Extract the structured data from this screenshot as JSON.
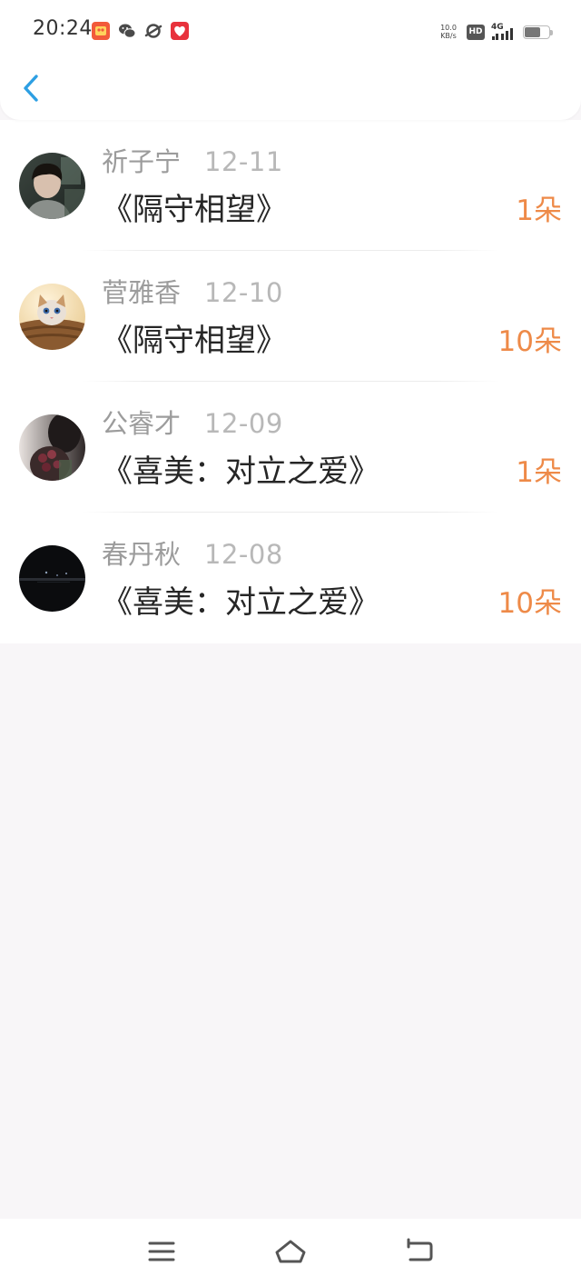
{
  "status_bar": {
    "time": "20:24",
    "net_speed_value": "10.0",
    "net_speed_unit": "KB/s",
    "hd_label": "HD",
    "network_label": "4G",
    "battery_level": 0.65,
    "app_icons": [
      "app-store-icon",
      "wechat-icon",
      "browser-icon",
      "heart-app-icon"
    ]
  },
  "header": {
    "back_icon": "chevron-left-icon",
    "accent_color": "#2d9fe3"
  },
  "items": [
    {
      "name": "祈子宁",
      "date": "12-11",
      "title": "《隔守相望》",
      "count": "1朵"
    },
    {
      "name": "菅雅香",
      "date": "12-10",
      "title": "《隔守相望》",
      "count": "10朵"
    },
    {
      "name": "公睿才",
      "date": "12-09",
      "title": "《喜美：对立之爱》",
      "count": "1朵"
    },
    {
      "name": "春丹秋",
      "date": "12-08",
      "title": "《喜美：对立之爱》",
      "count": "10朵"
    }
  ],
  "nav_bar": {
    "menu_icon": "menu-icon",
    "home_icon": "home-icon",
    "back_icon": "return-icon"
  },
  "colors": {
    "count": "#ee8a48",
    "name": "#9c9c9c",
    "date": "#b8b8b8",
    "title": "#262626",
    "background": "#f8f6f8"
  }
}
